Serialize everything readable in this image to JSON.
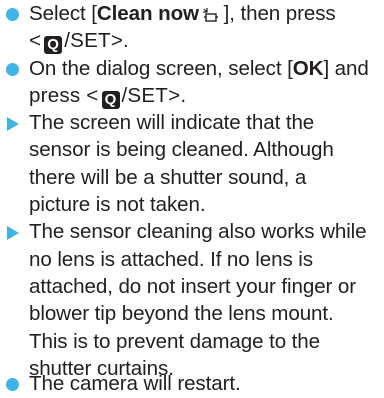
{
  "steps": [
    {
      "marker": "circle-bullet",
      "line1_pre": "Select [",
      "line1_bold": "Clean now",
      "line1_post": " ], then press",
      "line2_open": "<",
      "button_key": "Q",
      "button_suffix": "/SET",
      "line2_close": ">."
    },
    {
      "marker": "circle-bullet",
      "line1_pre": "On the dialog screen, select [",
      "line1_bold": "OK",
      "line1_post": "] and",
      "line2_pre": "press ",
      "line2_open": "<",
      "button_key": "Q",
      "button_suffix": "/SET",
      "line2_close": ">."
    },
    {
      "marker": "triangle-arrow",
      "lines": [
        "The screen will indicate that the",
        "sensor is being cleaned. Although",
        "there will be a shutter sound, a",
        "picture is not taken."
      ]
    },
    {
      "marker": "triangle-arrow",
      "lines": [
        "The sensor cleaning also works while",
        "no lens is attached. If no lens is",
        "attached, do not insert your finger or",
        "blower tip beyond the lens mount.",
        "This is to prevent damage to the",
        "shutter curtains."
      ]
    },
    {
      "marker": "circle-bullet",
      "lines": [
        "The camera will restart."
      ]
    }
  ],
  "colors": {
    "marker": "#3fb4e6",
    "text": "#231f20"
  },
  "icons": {
    "clean_now": "sensor-cleaning-icon",
    "button": "quick-control-button-icon"
  }
}
